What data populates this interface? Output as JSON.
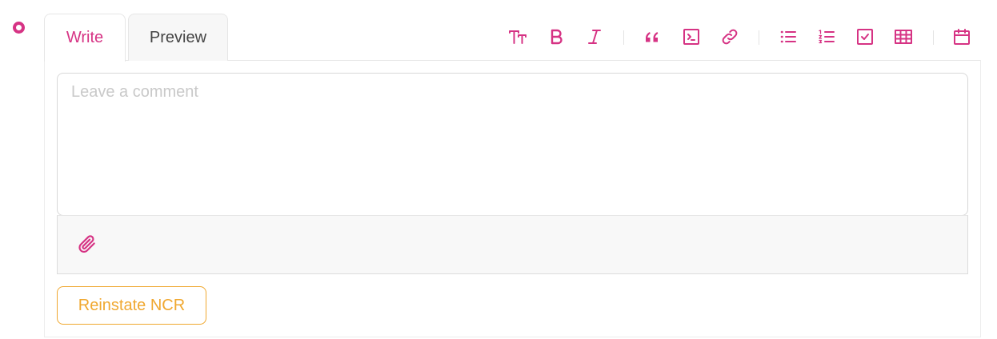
{
  "tabs": {
    "write": "Write",
    "preview": "Preview",
    "active": "write"
  },
  "editor": {
    "placeholder": "Leave a comment",
    "value": ""
  },
  "toolbar": {
    "icons": [
      "heading-icon",
      "bold-icon",
      "italic-icon",
      "quote-icon",
      "code-icon",
      "link-icon",
      "bullet-list-icon",
      "numbered-list-icon",
      "task-list-icon",
      "table-icon",
      "calendar-icon"
    ]
  },
  "actions": {
    "reinstate_label": "Reinstate NCR"
  },
  "colors": {
    "accent": "#d63384",
    "warning": "#f0a830",
    "placeholder": "#c9c9c9"
  }
}
